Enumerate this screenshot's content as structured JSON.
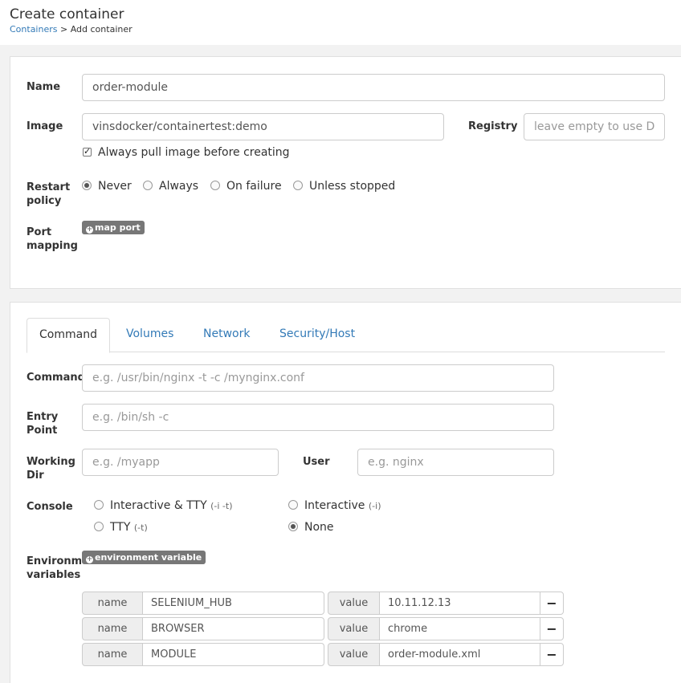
{
  "header": {
    "title": "Create container",
    "breadcrumb_link": "Containers",
    "breadcrumb_sep": ">",
    "breadcrumb_current": "Add container"
  },
  "form": {
    "name_label": "Name",
    "name_value": "order-module",
    "image_label": "Image",
    "image_value": "vinsdocker/containertest:demo",
    "registry_label": "Registry",
    "registry_placeholder": "leave empty to use D",
    "pull_label": "Always pull image before creating",
    "pull_checked": true,
    "restart_label_1": "Restart",
    "restart_label_2": "policy",
    "restart_options": [
      "Never",
      "Always",
      "On failure",
      "Unless stopped"
    ],
    "restart_selected": "Never",
    "port_label_1": "Port",
    "port_label_2": "mapping",
    "map_port_button": "map port"
  },
  "tabs": [
    "Command",
    "Volumes",
    "Network",
    "Security/Host"
  ],
  "active_tab": "Command",
  "command": {
    "command_label": "Command",
    "command_placeholder": "e.g. /usr/bin/nginx -t -c /mynginx.conf",
    "entry_label_1": "Entry",
    "entry_label_2": "Point",
    "entry_placeholder": "e.g. /bin/sh -c",
    "workdir_label_1": "Working",
    "workdir_label_2": "Dir",
    "workdir_placeholder": "e.g. /myapp",
    "user_label": "User",
    "user_placeholder": "e.g. nginx",
    "console_label": "Console",
    "console_options": [
      {
        "label": "Interactive & TTY",
        "hint": "(-i -t)"
      },
      {
        "label": "Interactive",
        "hint": "(-i)"
      },
      {
        "label": "TTY",
        "hint": "(-t)"
      },
      {
        "label": "None",
        "hint": ""
      }
    ],
    "console_selected": "None",
    "env_label_1": "Environment",
    "env_label_2": "variables",
    "env_button": "environment variable",
    "env_name_addon": "name",
    "env_value_addon": "value",
    "env_remove": "−",
    "env_vars": [
      {
        "name": "SELENIUM_HUB",
        "value": "10.11.12.13"
      },
      {
        "name": "BROWSER",
        "value": "chrome"
      },
      {
        "name": "MODULE",
        "value": "order-module.xml"
      }
    ]
  }
}
